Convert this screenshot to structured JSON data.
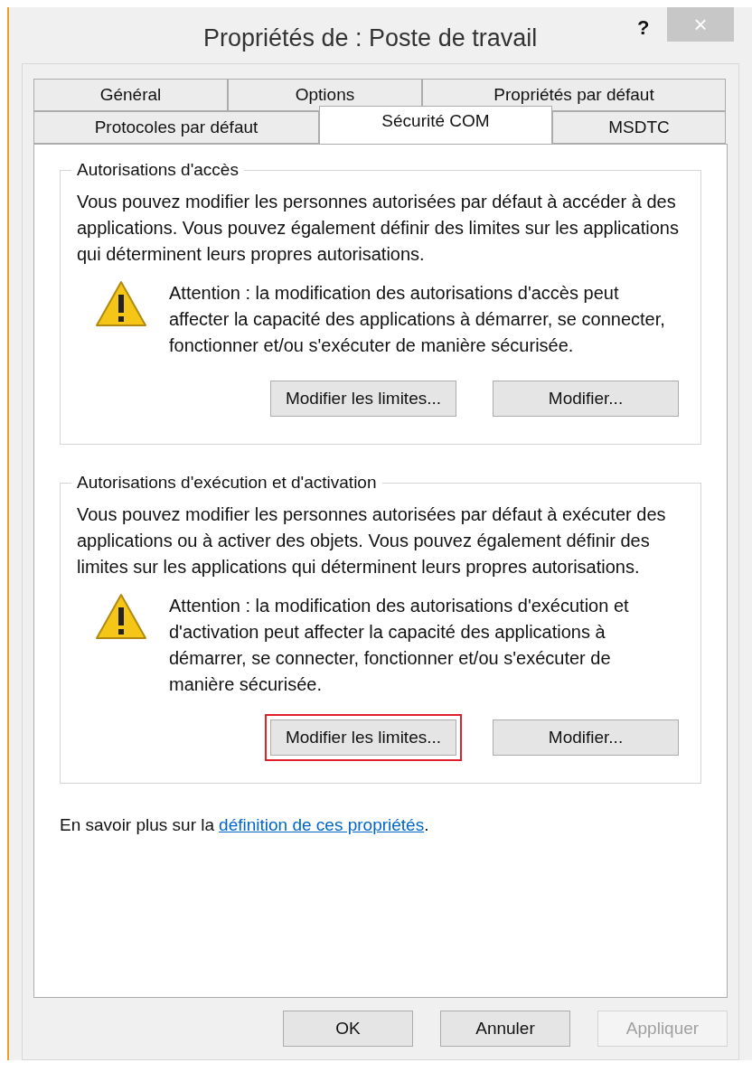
{
  "window": {
    "title": "Propriétés de : Poste de travail",
    "help": "?",
    "close": "×"
  },
  "tab_rows": [
    [
      {
        "label": "Général",
        "selected": false
      },
      {
        "label": "Options",
        "selected": false
      },
      {
        "label": "Propriétés par défaut",
        "selected": false
      }
    ],
    [
      {
        "label": "Protocoles par défaut",
        "selected": false
      },
      {
        "label": "Sécurité COM",
        "selected": true
      },
      {
        "label": "MSDTC",
        "selected": false
      }
    ]
  ],
  "groups": [
    {
      "title": "Autorisations d'accès",
      "description": "Vous pouvez modifier les personnes autorisées par défaut à accéder à des applications. Vous pouvez également définir des limites sur les applications qui déterminent leurs propres autorisations.",
      "warning": "Attention : la modification des autorisations d'accès peut affecter la capacité des applications à démarrer, se connecter, fonctionner et/ou s'exécuter de manière sécurisée.",
      "buttons": [
        {
          "label": "Modifier les limites...",
          "highlighted": false
        },
        {
          "label": "Modifier...",
          "highlighted": false
        }
      ]
    },
    {
      "title": "Autorisations d'exécution et d'activation",
      "description": "Vous pouvez modifier les personnes autorisées par défaut à exécuter des applications ou à activer des objets. Vous pouvez également définir des limites sur les applications qui déterminent leurs propres autorisations.",
      "warning": "Attention : la modification des autorisations d'exécution et d'activation peut affecter la capacité des applications à démarrer, se connecter, fonctionner et/ou s'exécuter de manière sécurisée.",
      "buttons": [
        {
          "label": "Modifier les limites...",
          "highlighted": true
        },
        {
          "label": "Modifier...",
          "highlighted": false
        }
      ]
    }
  ],
  "learn_more": {
    "text": "En savoir plus sur la",
    "link": "définition de ces propriétés",
    "suffix": "."
  },
  "footer_buttons": [
    {
      "label": "OK",
      "disabled": false
    },
    {
      "label": "Annuler",
      "disabled": false
    },
    {
      "label": "Appliquer",
      "disabled": true
    }
  ]
}
